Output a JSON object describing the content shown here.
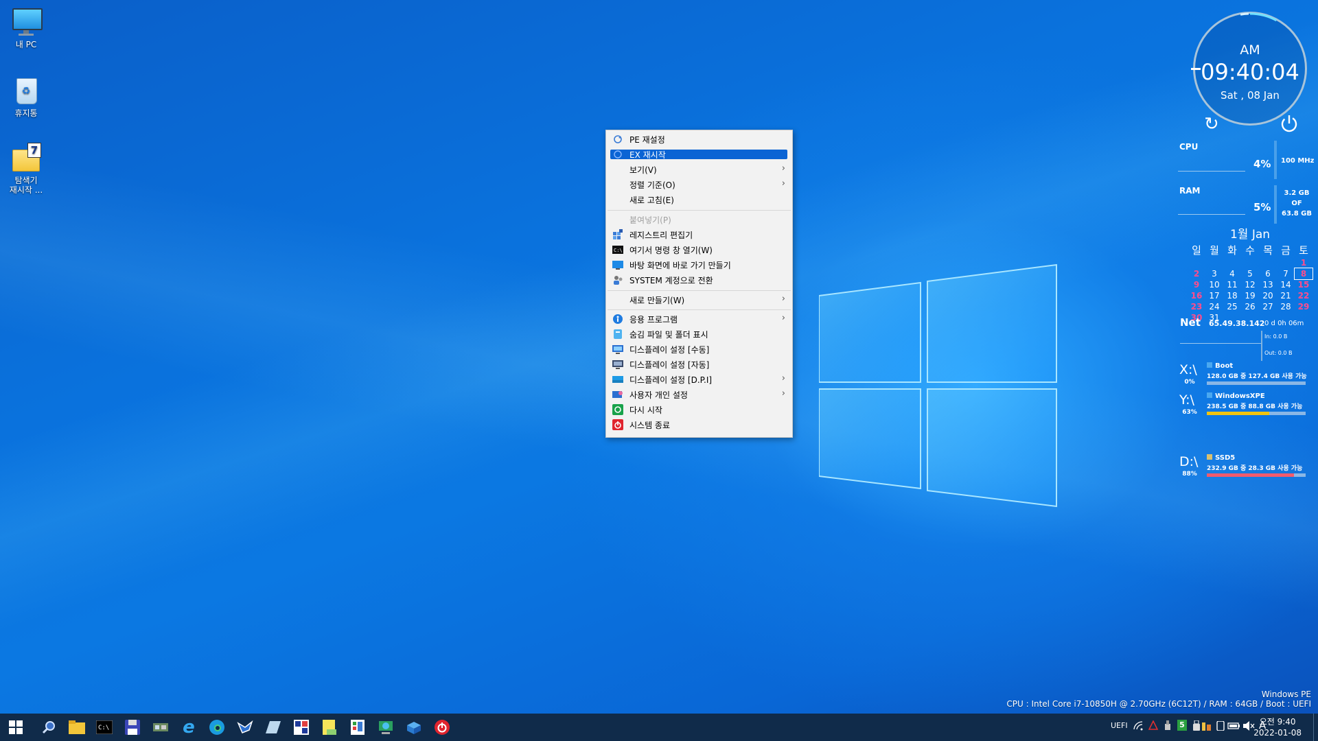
{
  "desktop": {
    "icons": [
      {
        "name": "mypc",
        "label": "내 PC"
      },
      {
        "name": "recyclebin",
        "label": "휴지통"
      },
      {
        "name": "explorer-restart",
        "label_line1": "탐색기",
        "label_line2": "재시작 ..."
      }
    ]
  },
  "context_menu": {
    "items": [
      {
        "label": "PE 재설정",
        "icon": "refresh-icon"
      },
      {
        "label": "EX 재시작",
        "icon": "restart-icon",
        "selected": true
      },
      {
        "label": "보기(V)",
        "submenu": true
      },
      {
        "label": "정렬 기준(O)",
        "submenu": true
      },
      {
        "label": "새로 고침(E)"
      },
      {
        "label": "붙여넣기(P)",
        "disabled": true
      },
      {
        "label": "레지스트리 편집기",
        "icon": "registry-icon"
      },
      {
        "label": "여기서 명령 창 열기(W)",
        "icon": "cmd-icon"
      },
      {
        "label": "바탕 화면에 바로 가기 만들기",
        "icon": "desktop-shortcut-icon"
      },
      {
        "label": "SYSTEM 계정으로 전환",
        "icon": "users-icon"
      },
      {
        "label": "새로 만들기(W)",
        "submenu": true
      },
      {
        "label": "응용 프로그램",
        "icon": "apps-icon",
        "submenu": true
      },
      {
        "label": "숨김 파일 및 폴더 표시",
        "icon": "hidden-files-icon"
      },
      {
        "label": "디스플레이 설정 [수동]",
        "icon": "display-icon"
      },
      {
        "label": "디스플레이 설정 [자동]",
        "icon": "display-icon"
      },
      {
        "label": "디스플레이 설정 [D.P.I]",
        "icon": "display-icon",
        "submenu": true
      },
      {
        "label": "사용자 개인 설정",
        "icon": "personalize-icon",
        "submenu": true
      },
      {
        "label": "다시 시작",
        "icon": "restart-green-icon"
      },
      {
        "label": "시스템 종료",
        "icon": "power-red-icon"
      }
    ],
    "arrow": "›"
  },
  "clock_widget": {
    "ampm": "AM",
    "time": "09:40:04",
    "date": "Sat , 08 Jan"
  },
  "cpu": {
    "label": "CPU",
    "percent": "4%",
    "freq": "100 MHz"
  },
  "ram": {
    "label": "RAM",
    "percent": "5%",
    "used": "3.2 GB",
    "of": "OF",
    "total": "63.8 GB"
  },
  "calendar": {
    "title": "1월 Jan",
    "weekdays": [
      "일",
      "월",
      "화",
      "수",
      "목",
      "금",
      "토"
    ],
    "weeks": [
      [
        "",
        "",
        "",
        "",
        "",
        "",
        "1"
      ],
      [
        "2",
        "3",
        "4",
        "5",
        "6",
        "7",
        "8"
      ],
      [
        "9",
        "10",
        "11",
        "12",
        "13",
        "14",
        "15"
      ],
      [
        "16",
        "17",
        "18",
        "19",
        "20",
        "21",
        "22"
      ],
      [
        "23",
        "24",
        "25",
        "26",
        "27",
        "28",
        "29"
      ],
      [
        "30",
        "31",
        "",
        "",
        "",
        "",
        ""
      ]
    ],
    "today": "8"
  },
  "net": {
    "label": "Net",
    "ip": "65.49.38.142",
    "uptime": "0 d 0h 06m",
    "in": "In: 0.0 B",
    "out": "Out: 0.0 B"
  },
  "drives": [
    {
      "letter": "X:\\",
      "pct": "0%",
      "name": "Boot",
      "info": "128.0 GB 중 127.4 GB 사용 가능",
      "fill": 0.005,
      "color": "#8ab7e6"
    },
    {
      "letter": "Y:\\",
      "pct": "63%",
      "name": "WindowsXPE",
      "info": "238.5 GB 중 88.8 GB 사용 가능",
      "fill": 0.63,
      "color": "#f2c40f"
    },
    {
      "letter": "D:\\",
      "pct": "88%",
      "name": "SSD5",
      "info": "232.9 GB 중 28.3 GB 사용 가능",
      "fill": 0.88,
      "color": "#f25b6d"
    }
  ],
  "watermark": {
    "line1": "Windows PE",
    "line2": "CPU : Intel Core i7-10850H @ 2.70GHz (6C12T) / RAM : 64GB / Boot : UEFI"
  },
  "taskbar": {
    "tray_text": "UEFI",
    "ime": "A",
    "clock_time": "오전 9:40",
    "clock_date": "2022-01-08",
    "tray_badge": "5"
  },
  "colors": {
    "accent": "#0b64d4",
    "taskbar": "#102b4a",
    "menu_bg": "#f2f2f2"
  }
}
